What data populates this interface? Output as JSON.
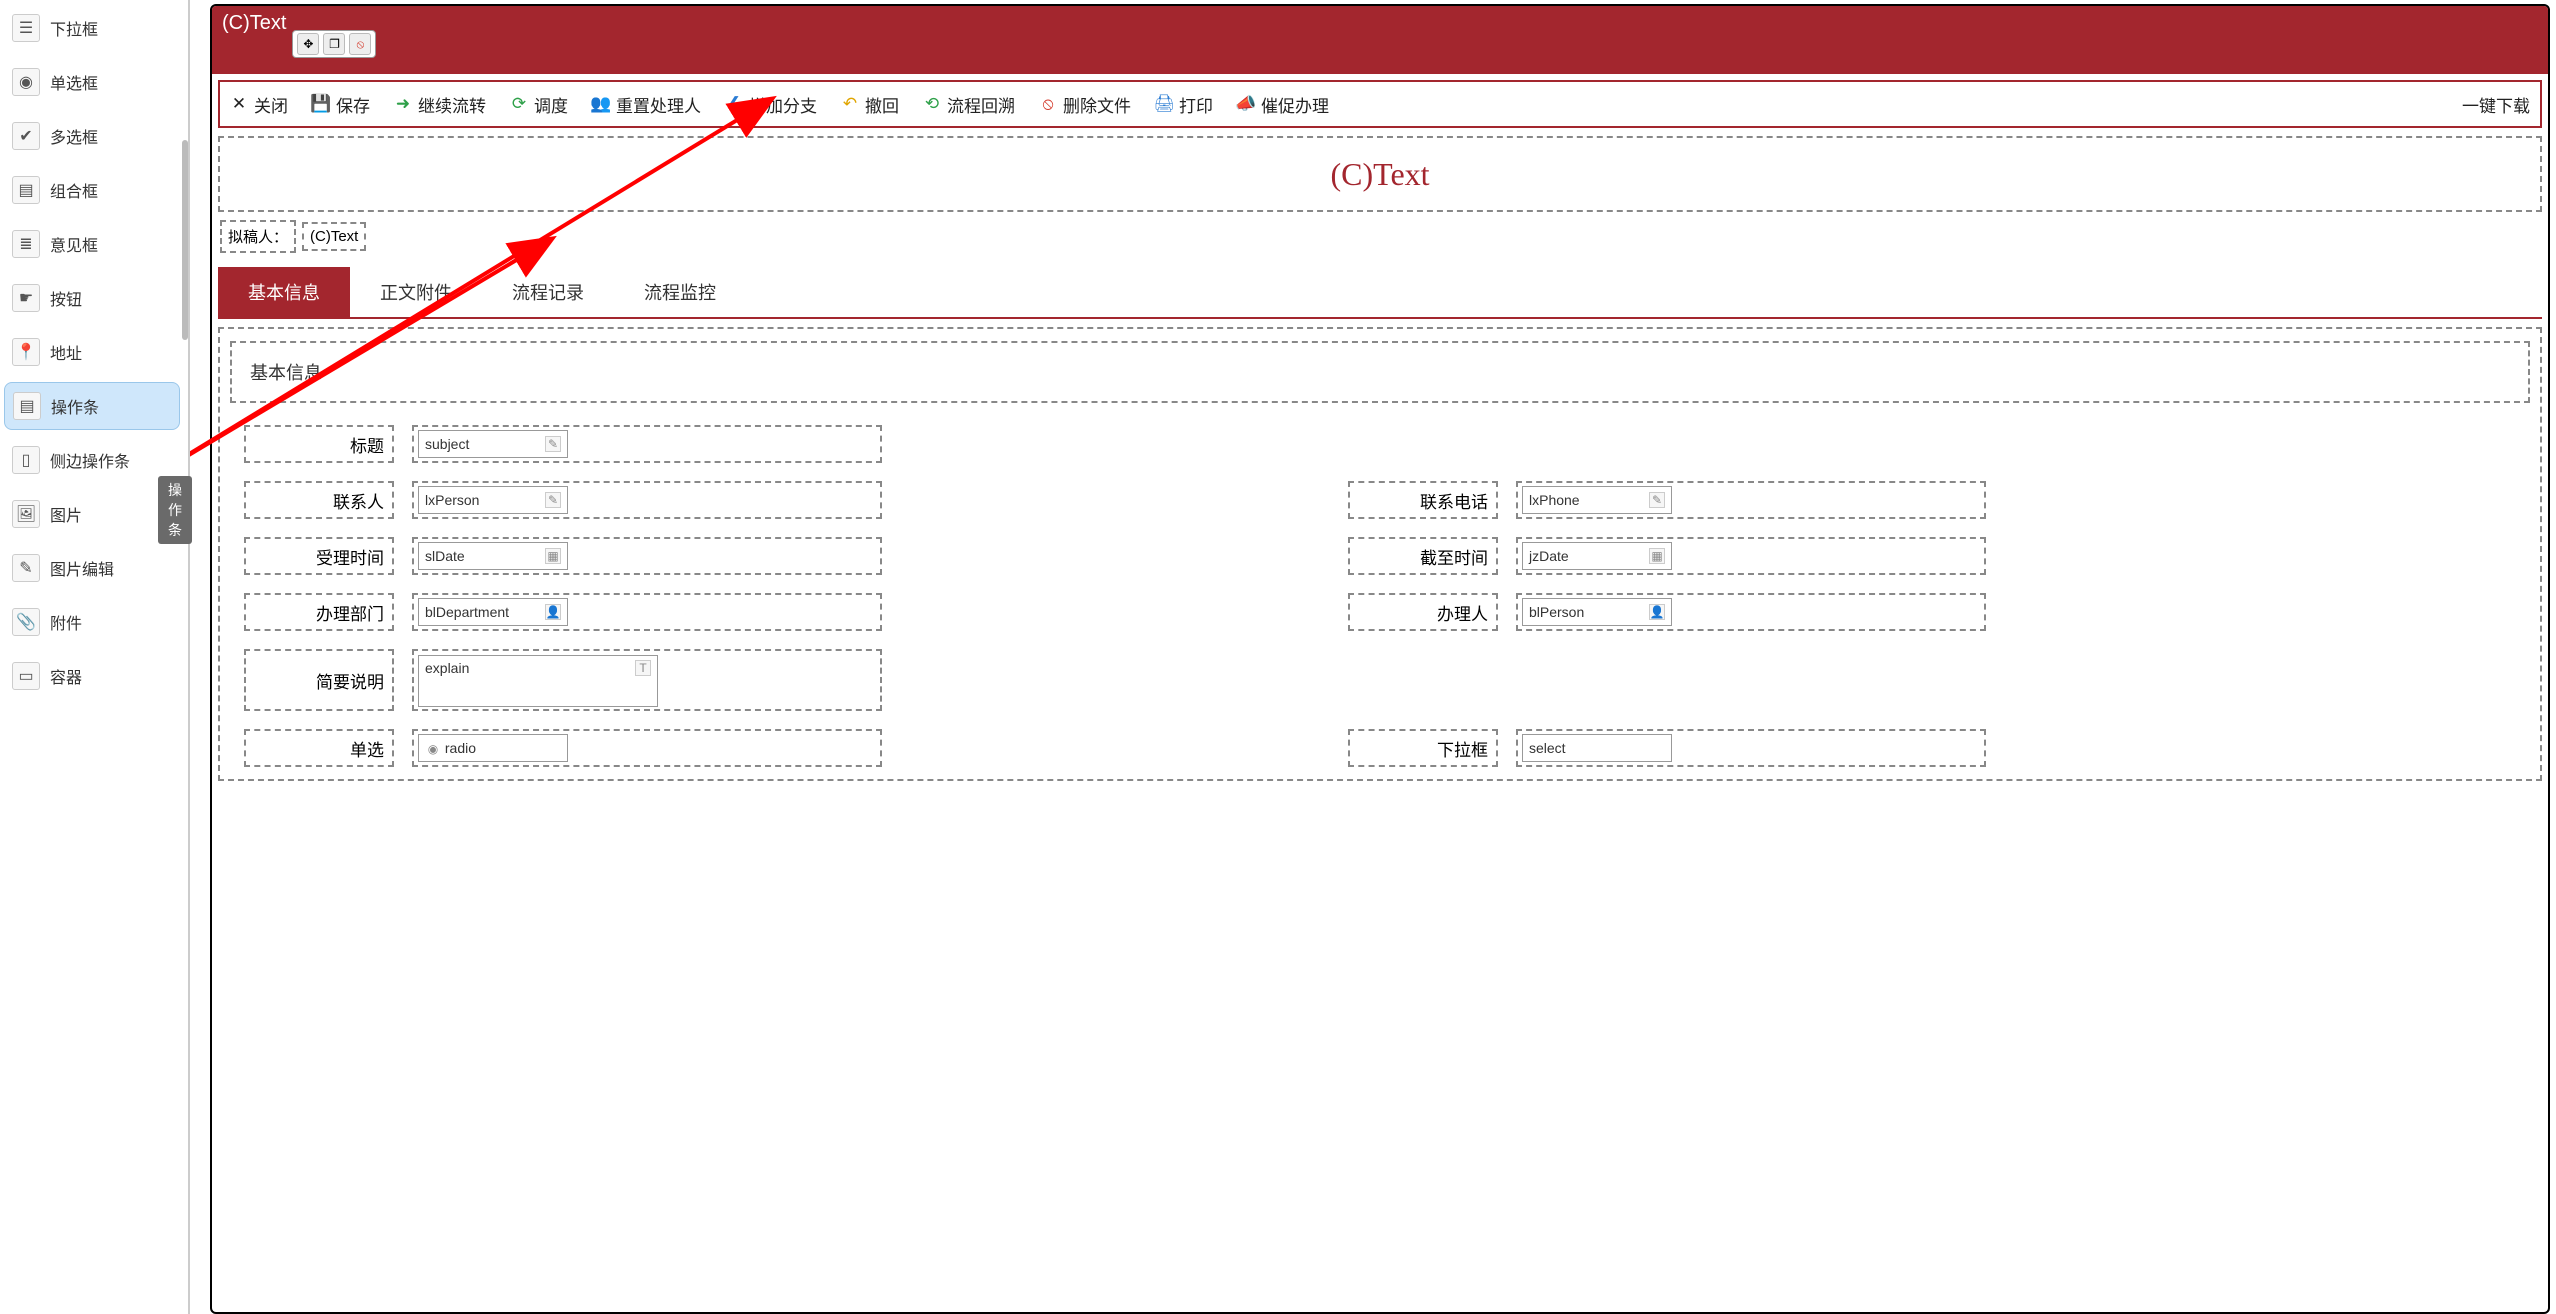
{
  "sidebar": {
    "items": [
      {
        "label": "下拉框",
        "icon": "☰"
      },
      {
        "label": "单选框",
        "icon": "◉"
      },
      {
        "label": "多选框",
        "icon": "✔"
      },
      {
        "label": "组合框",
        "icon": "▤"
      },
      {
        "label": "意见框",
        "icon": "≣"
      },
      {
        "label": "按钮",
        "icon": "☛"
      },
      {
        "label": "地址",
        "icon": "📍"
      },
      {
        "label": "操作条",
        "icon": "▤"
      },
      {
        "label": "侧边操作条",
        "icon": "▯"
      },
      {
        "label": "图片",
        "icon": "🖼"
      },
      {
        "label": "图片编辑",
        "icon": "✎"
      },
      {
        "label": "附件",
        "icon": "📎"
      },
      {
        "label": "容器",
        "icon": "▭"
      }
    ],
    "selectedIndex": 7,
    "tooltip": "操作条"
  },
  "redband": {
    "textPeek": "(C)Text"
  },
  "miniToolbar": {
    "moveIcon": "✥",
    "copyIcon": "❐",
    "deleteIcon": "⦸"
  },
  "toolbar": [
    {
      "label": "关闭",
      "icon": "✕",
      "color": "#333"
    },
    {
      "label": "保存",
      "icon": "💾",
      "color": "#2b7cd3"
    },
    {
      "label": "继续流转",
      "icon": "➜",
      "color": "#2ea049"
    },
    {
      "label": "调度",
      "icon": "⟳",
      "color": "#2ea049"
    },
    {
      "label": "重置处理人",
      "icon": "👥",
      "color": "#d98b2a"
    },
    {
      "label": "增加分支",
      "icon": "❮",
      "color": "#2b7cd3"
    },
    {
      "label": "撤回",
      "icon": "↶",
      "color": "#e0a500"
    },
    {
      "label": "流程回溯",
      "icon": "⟲",
      "color": "#2ea049"
    },
    {
      "label": "删除文件",
      "icon": "⦸",
      "color": "#d43c2e"
    },
    {
      "label": "打印",
      "icon": "🖨",
      "color": "#2b7cd3"
    },
    {
      "label": "催促办理",
      "icon": "📣",
      "color": "#d98b2a"
    },
    {
      "label": "一键下载",
      "icon": "",
      "color": "#333"
    }
  ],
  "titleBlock": "(C)Text",
  "drafter": {
    "label": "拟稿人：",
    "value": "(C)Text"
  },
  "tabs": [
    {
      "label": "基本信息",
      "active": true
    },
    {
      "label": "正文附件",
      "active": false
    },
    {
      "label": "流程记录",
      "active": false
    },
    {
      "label": "流程监控",
      "active": false
    }
  ],
  "section": {
    "title": "基本信息"
  },
  "form": {
    "row1": {
      "label1": "标题",
      "field1": "subject"
    },
    "row2": {
      "label1": "联系人",
      "field1": "lxPerson",
      "label2": "联系电话",
      "field2": "lxPhone"
    },
    "row3": {
      "label1": "受理时间",
      "field1": "slDate",
      "label2": "截至时间",
      "field2": "jzDate"
    },
    "row4": {
      "label1": "办理部门",
      "field1": "blDepartment",
      "label2": "办理人",
      "field2": "blPerson"
    },
    "row5": {
      "label1": "简要说明",
      "field1": "explain"
    },
    "row6": {
      "label1": "单选",
      "field1": "radio",
      "label2": "下拉框",
      "field2": "select"
    }
  },
  "icons": {
    "edit": "✎",
    "date": "▦",
    "person": "👤",
    "text": "T",
    "radio": "◉"
  }
}
